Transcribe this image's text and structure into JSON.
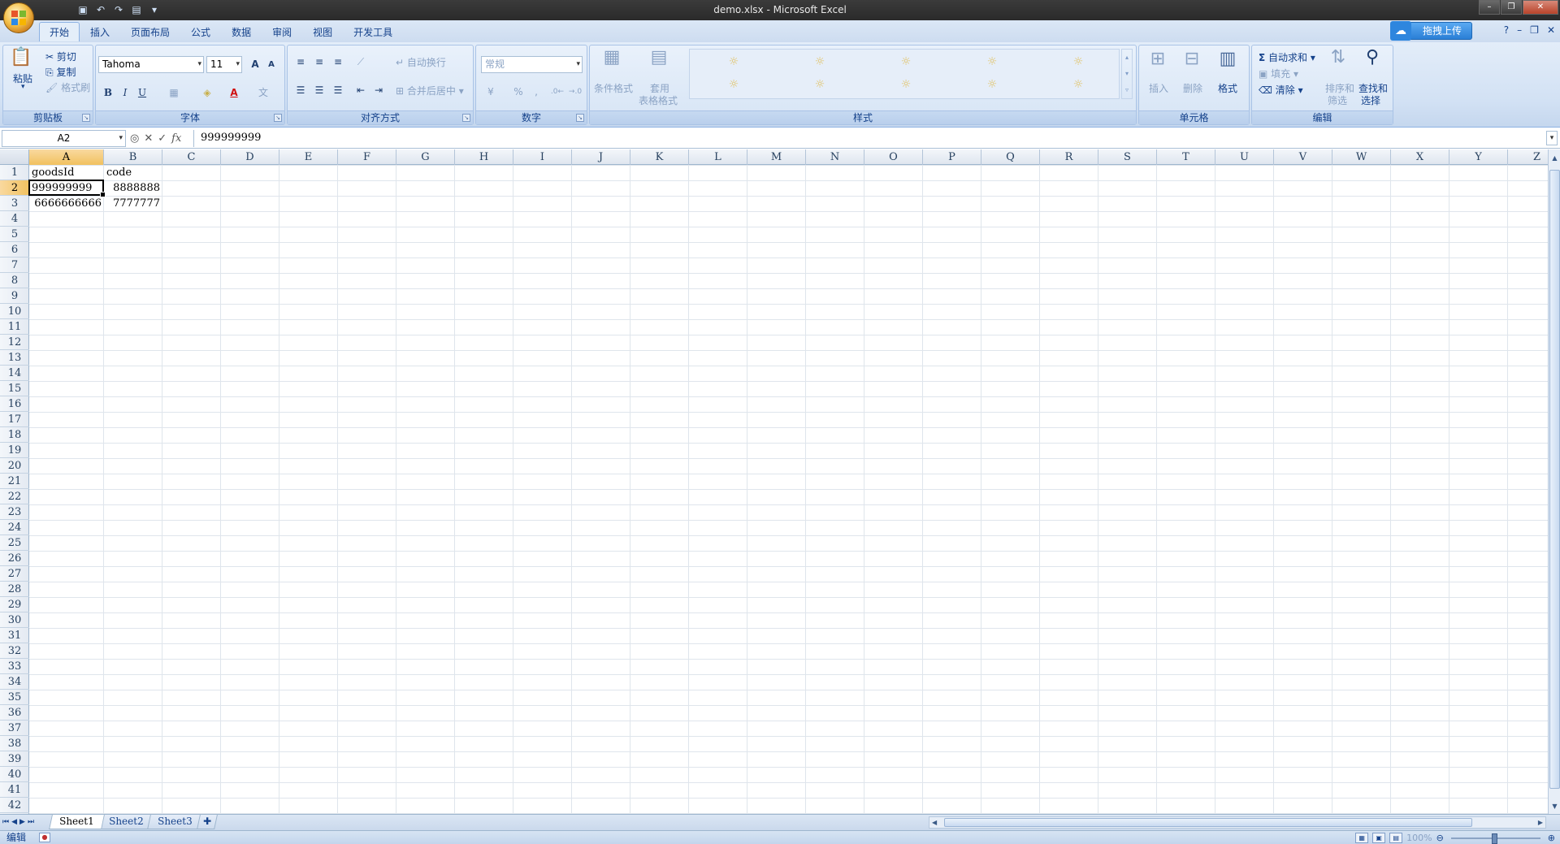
{
  "window": {
    "title": "demo.xlsx - Microsoft Excel",
    "controls": [
      "–",
      "❐",
      "✕"
    ]
  },
  "qat": {
    "icons": [
      "save-icon",
      "undo-icon",
      "redo-icon",
      "print-preview-icon",
      "customize-icon"
    ]
  },
  "tabs": [
    {
      "label": "开始",
      "active": true
    },
    {
      "label": "插入"
    },
    {
      "label": "页面布局"
    },
    {
      "label": "公式"
    },
    {
      "label": "数据"
    },
    {
      "label": "审阅"
    },
    {
      "label": "视图"
    },
    {
      "label": "开发工具"
    }
  ],
  "upload_label": "拖拽上传",
  "ribbon": {
    "clipboard": {
      "paste": "粘贴",
      "cut": "剪切",
      "copy": "复制",
      "format_painter": "格式刷",
      "label": "剪贴板"
    },
    "font": {
      "name": "Tahoma",
      "size": "11",
      "grow": "A",
      "shrink": "A",
      "bold": "B",
      "italic": "I",
      "underline": "U",
      "label": "字体"
    },
    "alignment": {
      "wrap": "自动换行",
      "merge": "合并后居中",
      "label": "对齐方式"
    },
    "number": {
      "format": "常规",
      "percent": "%",
      "comma": ",",
      "label": "数字"
    },
    "styles": {
      "conditional": "条件格式",
      "table_format_1": "套用",
      "table_format_2": "表格格式",
      "label": "样式"
    },
    "cells": {
      "insert": "插入",
      "delete": "删除",
      "format": "格式",
      "label": "单元格"
    },
    "editing": {
      "autosum": "自动求和",
      "fill": "填充",
      "clear": "清除",
      "sort_1": "排序和",
      "sort_2": "筛选",
      "find_1": "查找和",
      "find_2": "选择",
      "label": "编辑"
    }
  },
  "formula_bar": {
    "name_box": "A2",
    "cancel": "✕",
    "enter": "✓",
    "fx": "fx",
    "value": "999999999"
  },
  "sheet": {
    "columns": [
      "A",
      "B",
      "C",
      "D",
      "E",
      "F",
      "G",
      "H",
      "I",
      "J",
      "K",
      "L",
      "M",
      "N",
      "O",
      "P",
      "Q",
      "R",
      "S",
      "T",
      "U",
      "V",
      "W",
      "X",
      "Y",
      "Z"
    ],
    "selected_column": "A",
    "rows": [
      1,
      2,
      3,
      4,
      5,
      6,
      7,
      8,
      9,
      10,
      11,
      12,
      13,
      14,
      15,
      16,
      17,
      18,
      19,
      20,
      21,
      22,
      23,
      24,
      25,
      26,
      27,
      28,
      29,
      30,
      31,
      32,
      33,
      34,
      35,
      36,
      37,
      38,
      39,
      40,
      41,
      42
    ],
    "selected_row": 2,
    "selected_cell": "A2",
    "cells": [
      {
        "ref": "A1",
        "value": "goodsId",
        "align": "left"
      },
      {
        "ref": "B1",
        "value": "code",
        "align": "left"
      },
      {
        "ref": "A2",
        "value": "999999999",
        "align": "left"
      },
      {
        "ref": "B2",
        "value": "8888888",
        "align": "right"
      },
      {
        "ref": "A3",
        "value": "6666666666",
        "align": "right"
      },
      {
        "ref": "B3",
        "value": "7777777",
        "align": "right"
      }
    ]
  },
  "sheet_tabs": [
    {
      "label": "Sheet1",
      "active": true
    },
    {
      "label": "Sheet2"
    },
    {
      "label": "Sheet3"
    }
  ],
  "status": {
    "mode": "编辑",
    "zoom": "100%"
  }
}
